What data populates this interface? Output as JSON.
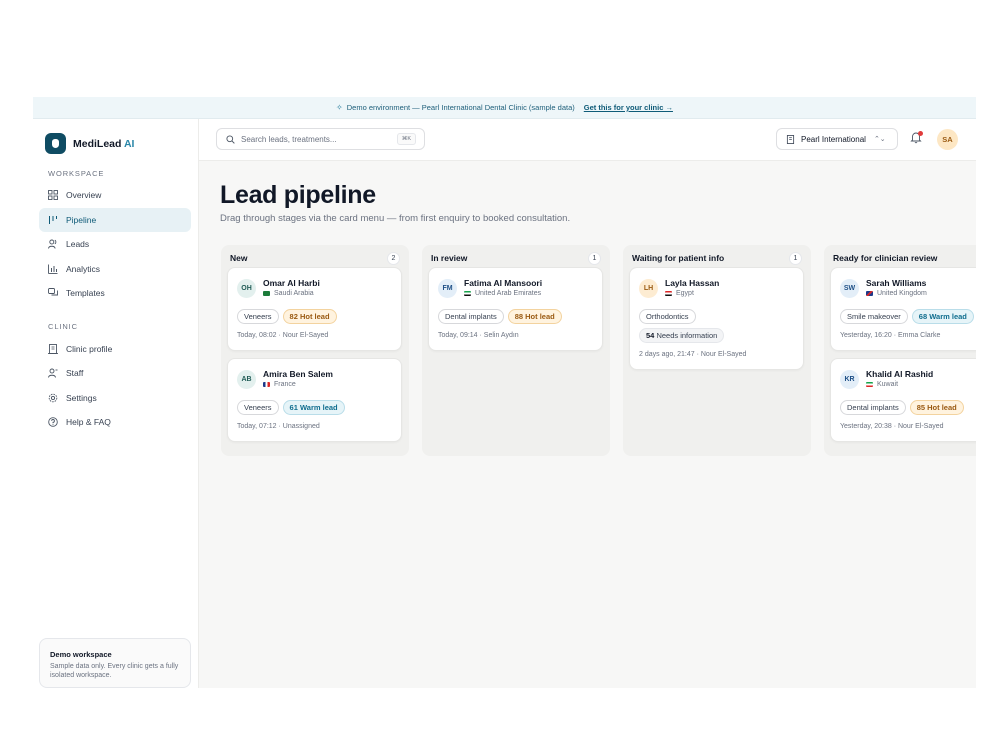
{
  "banner": {
    "text": "Demo environment — Pearl International Dental Clinic (sample data)",
    "cta": "Get this for your clinic →"
  },
  "sidebar": {
    "brand": {
      "name": "MediLead",
      "suffix": "AI"
    },
    "workspace_label": "WORKSPACE",
    "workspace_items": [
      {
        "label": "Overview",
        "icon": "grid-icon"
      },
      {
        "label": "Pipeline",
        "icon": "pipeline-icon",
        "active": true
      },
      {
        "label": "Leads",
        "icon": "users-icon"
      },
      {
        "label": "Analytics",
        "icon": "bar-chart-icon"
      },
      {
        "label": "Templates",
        "icon": "message-icon"
      }
    ],
    "clinic_label": "CLINIC",
    "clinic_items": [
      {
        "label": "Clinic profile",
        "icon": "building-icon"
      },
      {
        "label": "Staff",
        "icon": "staff-icon"
      },
      {
        "label": "Settings",
        "icon": "gear-icon"
      },
      {
        "label": "Help & FAQ",
        "icon": "help-icon"
      }
    ],
    "demo_card": {
      "title": "Demo workspace",
      "text": "Sample data only. Every clinic gets a fully isolated workspace."
    }
  },
  "topbar": {
    "search_placeholder": "Search leads, treatments...",
    "shortcut": "⌘K",
    "clinic": "Pearl International",
    "user_initials": "SA"
  },
  "page": {
    "title": "Lead pipeline",
    "subtitle": "Drag through stages via the card menu — from first enquiry to booked consultation."
  },
  "columns": [
    {
      "title": "New",
      "count": "2"
    },
    {
      "title": "In review",
      "count": "1"
    },
    {
      "title": "Waiting for patient info",
      "count": "1"
    },
    {
      "title": "Ready for clinician review",
      "count": ""
    }
  ],
  "cards": [
    {
      "initials": "OH",
      "name": "Omar Al Harbi",
      "country": "Saudi Arabia",
      "treatment": "Veneers",
      "score": "82",
      "score_label": "Hot lead",
      "meta": "Today, 08:02 · Nour El-Sayed"
    },
    {
      "initials": "AB",
      "name": "Amira Ben Salem",
      "country": "France",
      "treatment": "Veneers",
      "score": "61",
      "score_label": "Warm lead",
      "meta": "Today, 07:12 · Unassigned"
    },
    {
      "initials": "FM",
      "name": "Fatima Al Mansoori",
      "country": "United Arab Emirates",
      "treatment": "Dental implants",
      "score": "88",
      "score_label": "Hot lead",
      "meta": "Today, 09:14 · Selin Aydın"
    },
    {
      "initials": "LH",
      "name": "Layla Hassan",
      "country": "Egypt",
      "treatment": "Orthodontics",
      "info_count": "54",
      "info_label": "Needs information",
      "meta": "2 days ago, 21:47 · Nour El-Sayed"
    },
    {
      "initials": "SW",
      "name": "Sarah Williams",
      "country": "United Kingdom",
      "treatment": "Smile makeover",
      "score": "68",
      "score_label": "Warm lead",
      "meta": "Yesterday, 16:20 · Emma Clarke"
    },
    {
      "initials": "KR",
      "name": "Khalid Al Rashid",
      "country": "Kuwait",
      "treatment": "Dental implants",
      "score": "85",
      "score_label": "Hot lead",
      "meta": "Yesterday, 20:38 · Nour El-Sayed"
    }
  ],
  "colors": {
    "brand": "#0f4c63",
    "accent": "#2a86a8",
    "hot": "#9a5a12",
    "warm": "#0f6d8e"
  }
}
